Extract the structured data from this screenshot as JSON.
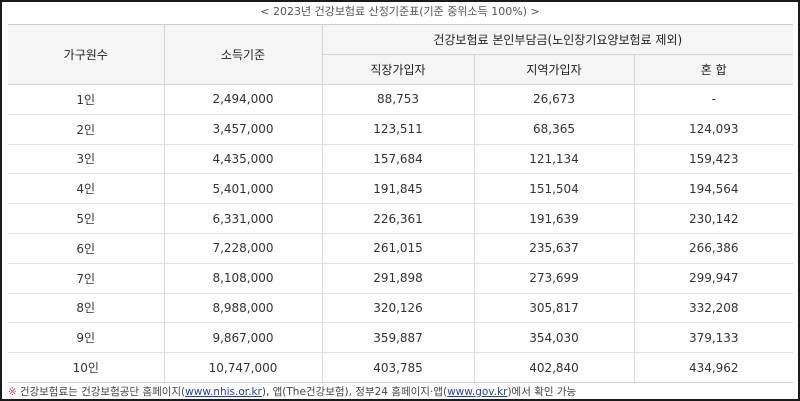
{
  "caption": "< 2023년 건강보험료 산정기준표(기준 중위소득 100%) >",
  "headers": {
    "household": "가구원수",
    "income": "소득기준",
    "group": "건강보험료 본인부담금(노인장기요양보험료 제외)",
    "employee": "직장가입자",
    "regional": "지역가입자",
    "mixed": "혼 합"
  },
  "rows": [
    {
      "household": "1인",
      "income": "2,494,000",
      "employee": "88,753",
      "regional": "26,673",
      "mixed": "-"
    },
    {
      "household": "2인",
      "income": "3,457,000",
      "employee": "123,511",
      "regional": "68,365",
      "mixed": "124,093"
    },
    {
      "household": "3인",
      "income": "4,435,000",
      "employee": "157,684",
      "regional": "121,134",
      "mixed": "159,423"
    },
    {
      "household": "4인",
      "income": "5,401,000",
      "employee": "191,845",
      "regional": "151,504",
      "mixed": "194,564"
    },
    {
      "household": "5인",
      "income": "6,331,000",
      "employee": "226,361",
      "regional": "191,639",
      "mixed": "230,142"
    },
    {
      "household": "6인",
      "income": "7,228,000",
      "employee": "261,015",
      "regional": "235,637",
      "mixed": "266,386"
    },
    {
      "household": "7인",
      "income": "8,108,000",
      "employee": "291,898",
      "regional": "273,699",
      "mixed": "299,947"
    },
    {
      "household": "8인",
      "income": "8,988,000",
      "employee": "320,126",
      "regional": "305,817",
      "mixed": "332,208"
    },
    {
      "household": "9인",
      "income": "9,867,000",
      "employee": "359,887",
      "regional": "354,030",
      "mixed": "379,133"
    },
    {
      "household": "10인",
      "income": "10,747,000",
      "employee": "403,785",
      "regional": "402,840",
      "mixed": "434,962"
    }
  ],
  "note": {
    "mark": "※",
    "text_1": "건강보험료는 건강보험공단 홈페이지(",
    "link_1": "www.nhis.or.kr",
    "text_2": "), 앱(The건강보험), 정부24 홈페이지·앱(",
    "link_2": "www.gov.kr",
    "text_3": ")에서 확인 가능"
  }
}
